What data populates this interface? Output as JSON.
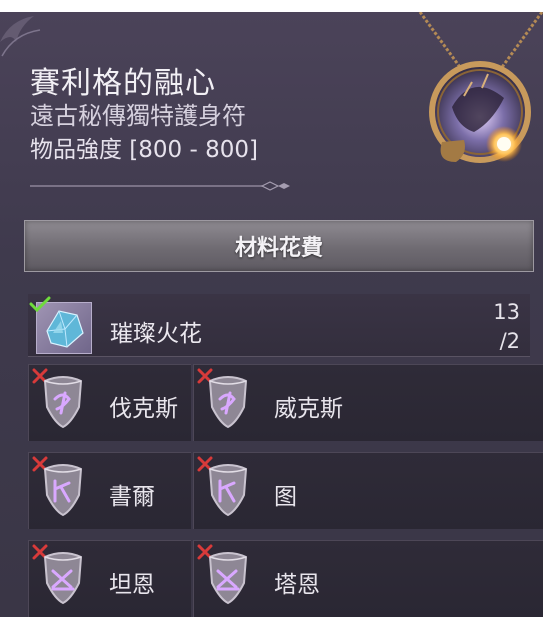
{
  "item": {
    "name": "賽利格的融心",
    "type": "遠古秘傳獨特護身符",
    "power": "物品強度 [800 - 800]"
  },
  "cost": {
    "header": "材料花費",
    "material": {
      "name": "璀璨火花",
      "count_owned": "13",
      "count_required": "/2",
      "met": true
    }
  },
  "runes": [
    {
      "name": "伐克斯",
      "met": false
    },
    {
      "name": "威克斯",
      "met": false
    },
    {
      "name": "書爾",
      "met": false
    },
    {
      "name": "图",
      "met": false
    },
    {
      "name": "坦恩",
      "met": false
    },
    {
      "name": "塔恩",
      "met": false
    }
  ],
  "colors": {
    "panel_bg": "#443e52",
    "check": "#6fdc3c",
    "cross": "#d83a3a",
    "rune_glyph": "#d9a8ff"
  },
  "icons": {
    "amulet": "amulet-icon",
    "crystal": "crystal-icon",
    "check": "check-icon",
    "cross": "x-icon",
    "rune": "rune-shield-icon"
  }
}
